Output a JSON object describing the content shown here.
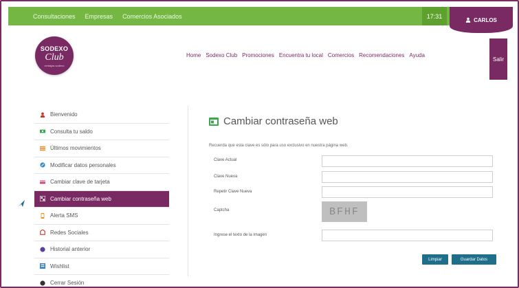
{
  "topbar": {
    "links": [
      "Consultaciones",
      "Empresas",
      "Comercios Asociados"
    ],
    "time": "17:31",
    "user": "CARLOS"
  },
  "logo": {
    "line1": "SODEXO",
    "line2": "Club",
    "tagline": "ventajas sodexo"
  },
  "nav": {
    "items": [
      "Home",
      "Sodexo Club",
      "Promociones",
      "Encuentra tu local",
      "Comercios",
      "Recomendaciones",
      "Ayuda"
    ],
    "logout": "Salir"
  },
  "sidebar": {
    "items": [
      {
        "label": "Bienvenido",
        "icon": "person-icon",
        "color": "#c0392b"
      },
      {
        "label": "Consulta tu saldo",
        "icon": "money-icon",
        "color": "#3aa84a"
      },
      {
        "label": "Últimos movimientos",
        "icon": "list-icon",
        "color": "#e8912d"
      },
      {
        "label": "Modificar datos personales",
        "icon": "edit-icon",
        "color": "#3a87c8"
      },
      {
        "label": "Cambiar clave de tarjeta",
        "icon": "card-icon",
        "color": "#d63a6b"
      },
      {
        "label": "Cambiar contraseña web",
        "icon": "key-icon",
        "color": "#ffffff"
      },
      {
        "label": "Alerta SMS",
        "icon": "phone-icon",
        "color": "#e8912d"
      },
      {
        "label": "Redes Sociales",
        "icon": "share-icon",
        "color": "#c0392b"
      },
      {
        "label": "Historial anterior",
        "icon": "history-icon",
        "color": "#5b3fa0"
      },
      {
        "label": "Wishlist",
        "icon": "wishlist-icon",
        "color": "#3a87c8"
      },
      {
        "label": "Cerrar Sesión",
        "icon": "logout-icon",
        "color": "#333333"
      }
    ],
    "active_index": 5
  },
  "main": {
    "title": "Cambiar contraseña web",
    "hint": "Recuerda que esta clave es sólo para uso exclusivo en nuestra página web.",
    "fields": [
      {
        "label": "Clave Actual",
        "value": ""
      },
      {
        "label": "Clave Nueva",
        "value": ""
      },
      {
        "label": "Repetir Clave Nueva",
        "value": ""
      }
    ],
    "captcha_label": "Captcha",
    "captcha_text": "BFHF",
    "captcha_input_label": "Ingrese el texto de la imagen",
    "captcha_input_value": "",
    "buttons": {
      "clear": "Limpiar",
      "save": "Guardar Datos"
    }
  },
  "colors": {
    "brand": "#7a2a63",
    "green": "#74b843",
    "button": "#1f6f8b"
  }
}
